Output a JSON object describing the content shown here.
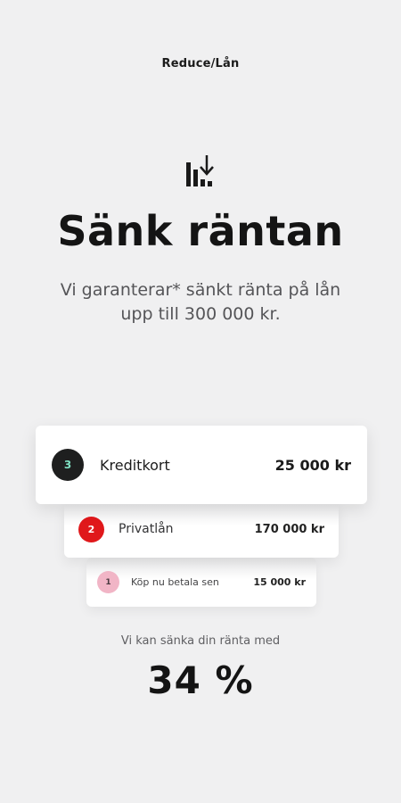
{
  "header": {
    "title": "Reduce/Lån"
  },
  "hero": {
    "icon": "bar-chart-decrease-icon",
    "title": "Sänk räntan",
    "subtitle": "Vi garanterar* sänkt ränta på lån upp till 300 000 kr."
  },
  "loans": [
    {
      "badge": "3",
      "label": "Kreditkort",
      "amount": "25 000 kr",
      "badge_color": "#1e1f1f"
    },
    {
      "badge": "2",
      "label": "Privatlån",
      "amount": "170 000 kr",
      "badge_color": "#e0181b"
    },
    {
      "badge": "1",
      "label": "Köp nu betala sen",
      "amount": "15 000 kr",
      "badge_color": "#f1b5c6"
    }
  ],
  "result": {
    "caption": "Vi kan sänka din ränta med",
    "value": "34 %"
  },
  "colors": {
    "background": "#f0f0f1",
    "text": "#141414",
    "accent_red": "#e0181b",
    "accent_pink": "#f1b5c6",
    "accent_mint": "#7fe0c2"
  }
}
